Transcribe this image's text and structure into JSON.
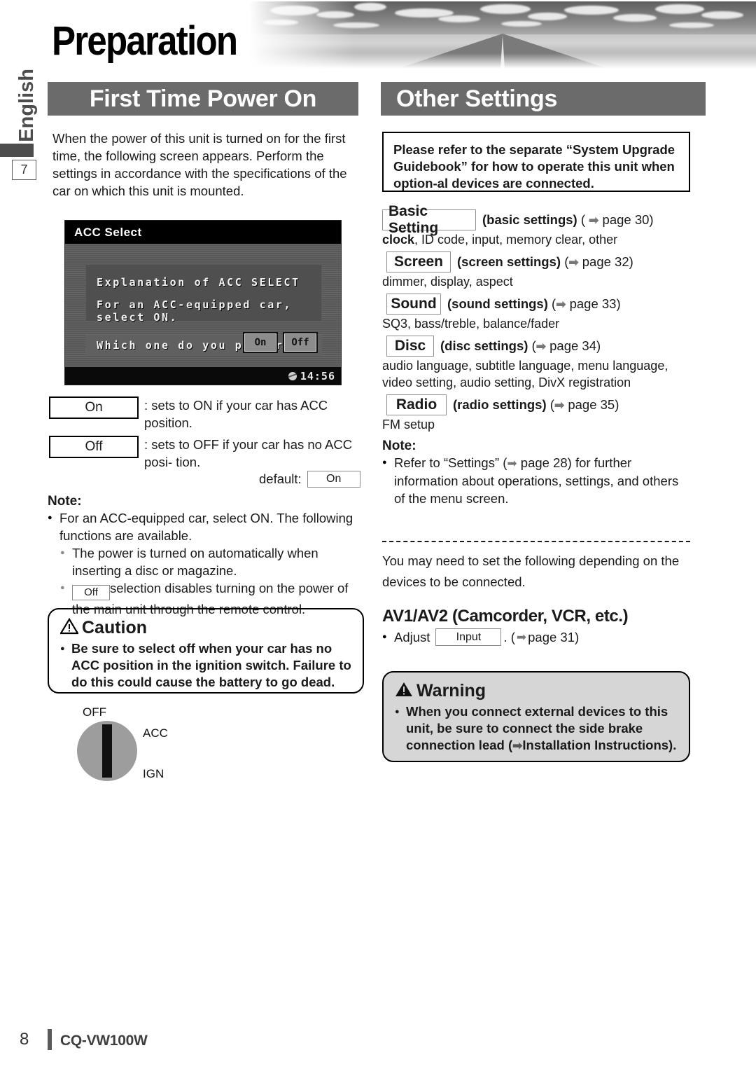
{
  "page": {
    "title": "Preparation",
    "language_tab": "English",
    "chapter_number": "7",
    "footer_page": "8",
    "footer_model": "CQ-VW100W"
  },
  "left": {
    "section_title": "First Time Power On",
    "intro": "When the power of this unit is turned on for the first time, the following screen appears. Perform the settings in accordance with the specifications of the car on which this unit is mounted.",
    "lcd": {
      "title": "ACC Select",
      "line1": "Explanation of ACC SELECT",
      "line2": "For an ACC-equipped car, select ON.",
      "question": "Which one do you prefer?",
      "btn_on": "On",
      "btn_off": "Off",
      "clock": "14:56",
      "clock_icon": "disc-icon"
    },
    "options": [
      {
        "key": "On",
        "desc": ": sets to ON if your car has ACC position."
      },
      {
        "key": "Off",
        "desc": ": sets to OFF if your car has no ACC posi- tion."
      }
    ],
    "default_label": "default:",
    "default_value": "On",
    "note_heading": "Note:",
    "note_l1": "For an ACC-equipped car, select ON.  The following functions are available.",
    "note_l2a": "The power is turned on automatically when inserting a disc or magazine.",
    "note_l2b_key": "Off",
    "note_l2b": "selection disables turning on the power of the main unit through the remote control.",
    "caution": {
      "icon": "warning-triangle-icon",
      "heading": "Caution",
      "body": "Be sure to select off when your car has no ACC position in the ignition switch. Failure to do this could cause the battery to go dead."
    },
    "ignition": {
      "off": "OFF",
      "acc": "ACC",
      "ign": "IGN"
    }
  },
  "right": {
    "section_title": "Other Settings",
    "refbox": "Please refer to the separate “System Upgrade Guidebook” for how to operate this unit when option-al devices are connected.",
    "settings": [
      {
        "key": "Basic Setting",
        "caption": "(basic settings)",
        "paren_open": "(",
        "arrow": "➡",
        "page": "page 30)",
        "sub_bold": "clock",
        "sub": ", ID code, input, memory clear, other"
      },
      {
        "key": "Screen",
        "caption": "(screen settings)",
        "paren_open": "(",
        "arrow": "➡",
        "page": "page 32)",
        "sub_bold": "",
        "sub": "dimmer, display, aspect"
      },
      {
        "key": "Sound",
        "caption": "(sound settings)",
        "paren_open": "(",
        "arrow": "➡",
        "page": "page 33)",
        "sub_bold": "",
        "sub": "SQ3, bass/treble, balance/fader"
      },
      {
        "key": "Disc",
        "caption": "(disc settings)",
        "paren_open": "(",
        "arrow": "➡",
        "page": "page 34)",
        "sub_bold": "",
        "sub": "audio language, subtitle language, menu language, video setting, audio setting, DivX registration"
      },
      {
        "key": "Radio",
        "caption": "(radio settings)",
        "paren_open": "(",
        "arrow": "➡",
        "page": "page 35)",
        "sub_bold": "",
        "sub": "FM setup"
      }
    ],
    "note_heading": "Note:",
    "note_text_a": "Refer to “Settings” (",
    "note_arrow": "➡",
    "note_text_b": " page 28) for further information about operations, settings, and others of the menu screen.",
    "connect_text": "You may need to set the following depending on the devices to be connected.",
    "av_heading": "AV1/AV2 (Camcorder, VCR, etc.)",
    "av_adjust": "Adjust",
    "av_key": "Input",
    "av_after": ". (",
    "av_arrow": "➡",
    "av_page": " page 31)",
    "warning": {
      "icon": "warning-triangle-filled-icon",
      "heading": "Warning",
      "body_a": "When you connect external devices to this unit, be sure to connect the side brake connection lead (",
      "arrow": "➡",
      "body_b": "Installation Instructions)."
    }
  }
}
